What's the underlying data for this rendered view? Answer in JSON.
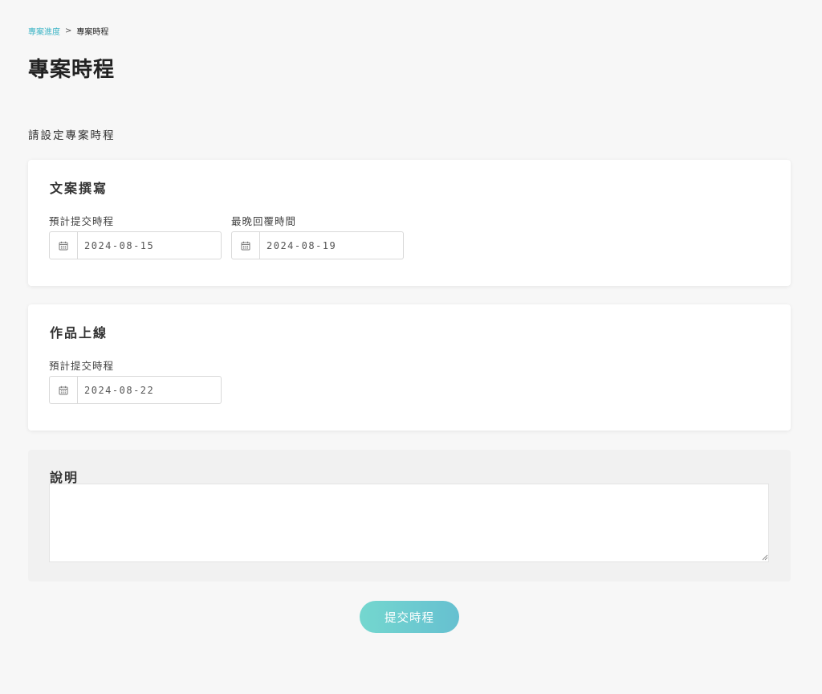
{
  "breadcrumb": {
    "parent": "專案進度",
    "separator": ">",
    "current": "專案時程"
  },
  "page_title": "專案時程",
  "section_heading": "請設定專案時程",
  "cards": [
    {
      "title": "文案撰寫",
      "fields": [
        {
          "label": "預計提交時程",
          "value": "2024-08-15",
          "icon": "calendar-icon"
        },
        {
          "label": "最晚回覆時間",
          "value": "2024-08-19",
          "icon": "calendar-icon"
        }
      ]
    },
    {
      "title": "作品上線",
      "fields": [
        {
          "label": "預計提交時程",
          "value": "2024-08-22",
          "icon": "calendar-icon"
        }
      ]
    }
  ],
  "description": {
    "title": "說明",
    "value": ""
  },
  "submit": {
    "label": "提交時程"
  },
  "colors": {
    "accent": "#3eb5c6",
    "button_start": "#74d7cf",
    "button_end": "#66c0d0",
    "background": "#f7f7f7"
  }
}
